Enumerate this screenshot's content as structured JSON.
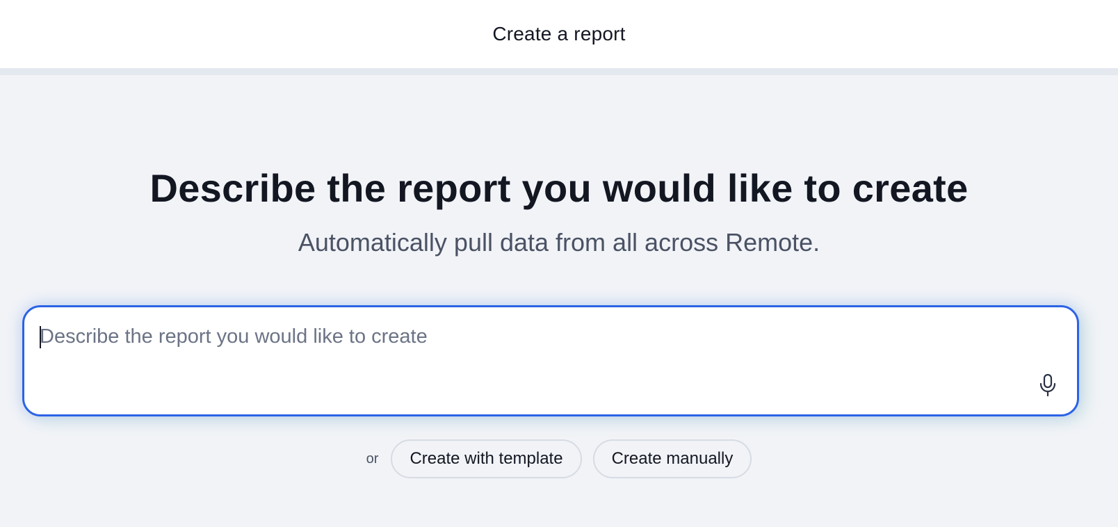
{
  "header": {
    "title": "Create a report"
  },
  "hero": {
    "heading": "Describe the report you would like to create",
    "subheading": "Automatically pull data from all across Remote."
  },
  "prompt": {
    "value": "",
    "placeholder": "Describe the report you would like to create",
    "mic_icon": "microphone-icon"
  },
  "actions": {
    "or_label": "or",
    "template_button": "Create with template",
    "manual_button": "Create manually"
  },
  "colors": {
    "background": "#f1f3f7",
    "accent": "#2b63e6",
    "text": "#131722",
    "muted": "#4a5264"
  }
}
